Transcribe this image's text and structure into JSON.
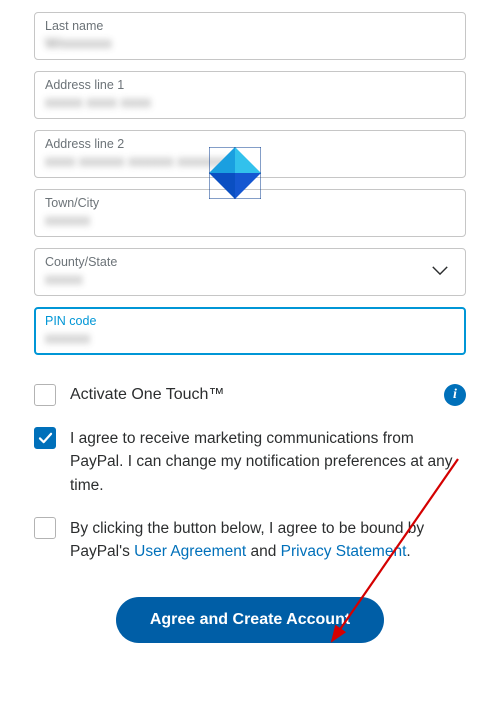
{
  "fields": {
    "lastname_label": "Last name",
    "addr1_label": "Address line 1",
    "addr2_label": "Address line 2",
    "city_label": "Town/City",
    "state_label": "County/State",
    "pin_label": "PIN code"
  },
  "onetouch_label": "Activate One Touch™",
  "checkboxes": {
    "marketing_text": "I agree to receive marketing communications from PayPal. I can change my notification preferences at any time.",
    "terms_prefix": "By clicking the button below, I agree to be bound by PayPal's ",
    "user_agreement": "User Agreement",
    "terms_mid": " and ",
    "privacy": "Privacy Statement",
    "terms_suffix": "."
  },
  "submit_label": "Agree and Create Account",
  "colors": {
    "accent": "#0070ba",
    "button": "#005ea6",
    "focus": "#0096d6"
  }
}
